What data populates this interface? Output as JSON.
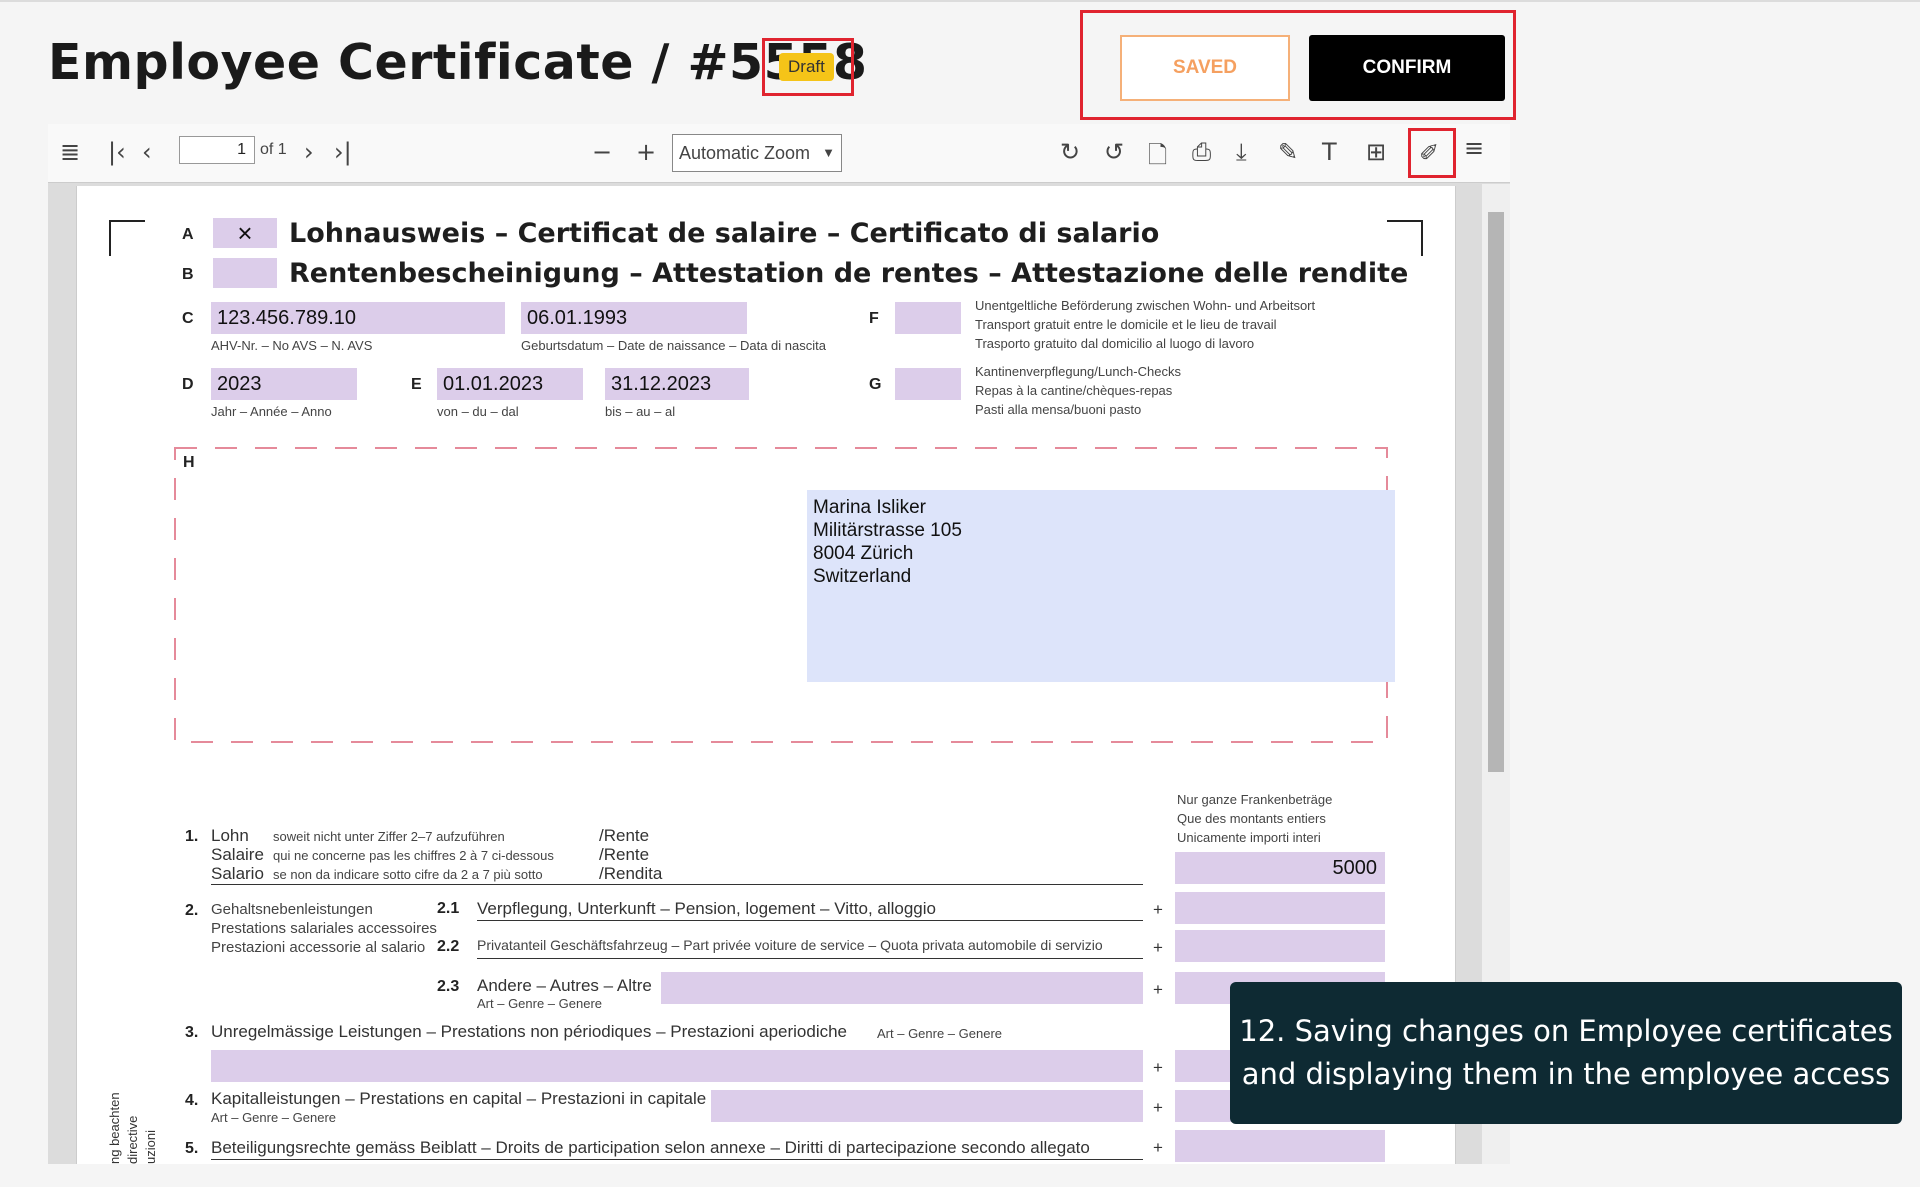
{
  "header": {
    "title": "Employee Certificate / #5558",
    "status": "Draft",
    "saved_label": "SAVED",
    "confirm_label": "CONFIRM"
  },
  "toolbar": {
    "page_value": "1",
    "page_of": "of 1",
    "zoom": "Automatic Zoom"
  },
  "form": {
    "row_a": {
      "letter": "A",
      "mark": "×",
      "title": "Lohnausweis – Certificat de salaire – Certificato di salario"
    },
    "row_b": {
      "letter": "B",
      "title": "Rentenbescheinigung – Attestation de rentes – Attestazione delle rendite"
    },
    "row_c": {
      "letter": "C",
      "ahv": "123.456.789.10",
      "ahv_caption": "AHV-Nr. – No AVS – N. AVS",
      "birth": "06.01.1993",
      "birth_caption": "Geburtsdatum – Date de naissance – Data di nascita"
    },
    "row_f": {
      "letter": "F",
      "lines": [
        "Unentgeltliche Beförderung zwischen Wohn- und Arbeitsort",
        "Transport gratuit entre le domicile et le lieu de travail",
        "Trasporto gratuito dal domicilio al luogo di lavoro"
      ]
    },
    "row_d": {
      "letter": "D",
      "year": "2023",
      "year_caption": "Jahr – Année – Anno"
    },
    "row_e": {
      "letter": "E",
      "from": "01.01.2023",
      "from_caption": "von – du – dal",
      "to": "31.12.2023",
      "to_caption": "bis – au – al"
    },
    "row_g": {
      "letter": "G",
      "lines": [
        "Kantinenverpflegung/Lunch-Checks",
        "Repas à la cantine/chèques-repas",
        "Pasti alla mensa/buoni pasto"
      ]
    },
    "row_h": {
      "letter": "H",
      "address": [
        "Marina Isliker",
        "Militärstrasse 105",
        "8004 Zürich",
        "Switzerland"
      ]
    },
    "amount_note": [
      "Nur ganze Frankenbeträge",
      "Que des montants entiers",
      "Unicamente importi interi"
    ],
    "item1": {
      "num": "1.",
      "labels": [
        "Lohn",
        "Salaire",
        "Salario"
      ],
      "notes": [
        "soweit nicht unter Ziffer 2–7 aufzuführen",
        "qui ne concerne pas les chiffres 2 à 7 ci-dessous",
        "se non da indicare sotto cifre da 2 a 7 più sotto"
      ],
      "rente": [
        "/Rente",
        "/Rente",
        "/Rendita"
      ],
      "amount": "5000"
    },
    "item2": {
      "num": "2.",
      "labels": [
        "Gehaltsnebenleistungen",
        "Prestations salariales accessoires",
        "Prestazioni accessorie al salario"
      ],
      "sub1_num": "2.1",
      "sub1": "Verpflegung, Unterkunft – Pension, logement – Vitto, alloggio",
      "sub2_num": "2.2",
      "sub2": "Privatanteil Geschäftsfahrzeug – Part privée voiture de service – Quota privata automobile di servizio",
      "sub3_num": "2.3",
      "sub3": "Andere – Autres – Altre",
      "sub3_caption": "Art – Genre – Genere"
    },
    "item3": {
      "num": "3.",
      "label": "Unregelmässige Leistungen – Prestations non périodiques – Prestazioni aperiodiche",
      "caption": "Art – Genre – Genere"
    },
    "item4": {
      "num": "4.",
      "label": "Kapitalleistungen – Prestations en capital – Prestazioni in capitale",
      "caption": "Art – Genre – Genere"
    },
    "item5": {
      "num": "5.",
      "label": "Beteiligungsrechte gemäss Beiblatt – Droits de participation selon annexe – Diritti di partecipazione secondo allegato"
    },
    "plus": "+",
    "side_text": [
      "ng beachten",
      "directive",
      "uzioni"
    ]
  },
  "caption": {
    "lines": [
      "12. Saving changes on Employee certificates",
      "and displaying them in the employee access"
    ]
  },
  "icons": [
    "sidebar-toggle-icon",
    "first-page-icon",
    "previous-page-icon",
    "next-page-icon",
    "last-page-icon",
    "zoom-out-icon",
    "zoom-in-icon",
    "rotate-cw-icon",
    "rotate-ccw-icon",
    "open-file-icon",
    "print-icon",
    "download-icon",
    "highlight-icon",
    "text-icon",
    "add-image-icon",
    "draw-icon",
    "menu-icon"
  ],
  "colors": {
    "accent_red": "#e0242f",
    "draft_badge": "#f5c418",
    "field_fill": "#dccdea",
    "address_fill": "#dde4fa",
    "caption_bg": "#0e2a33"
  }
}
